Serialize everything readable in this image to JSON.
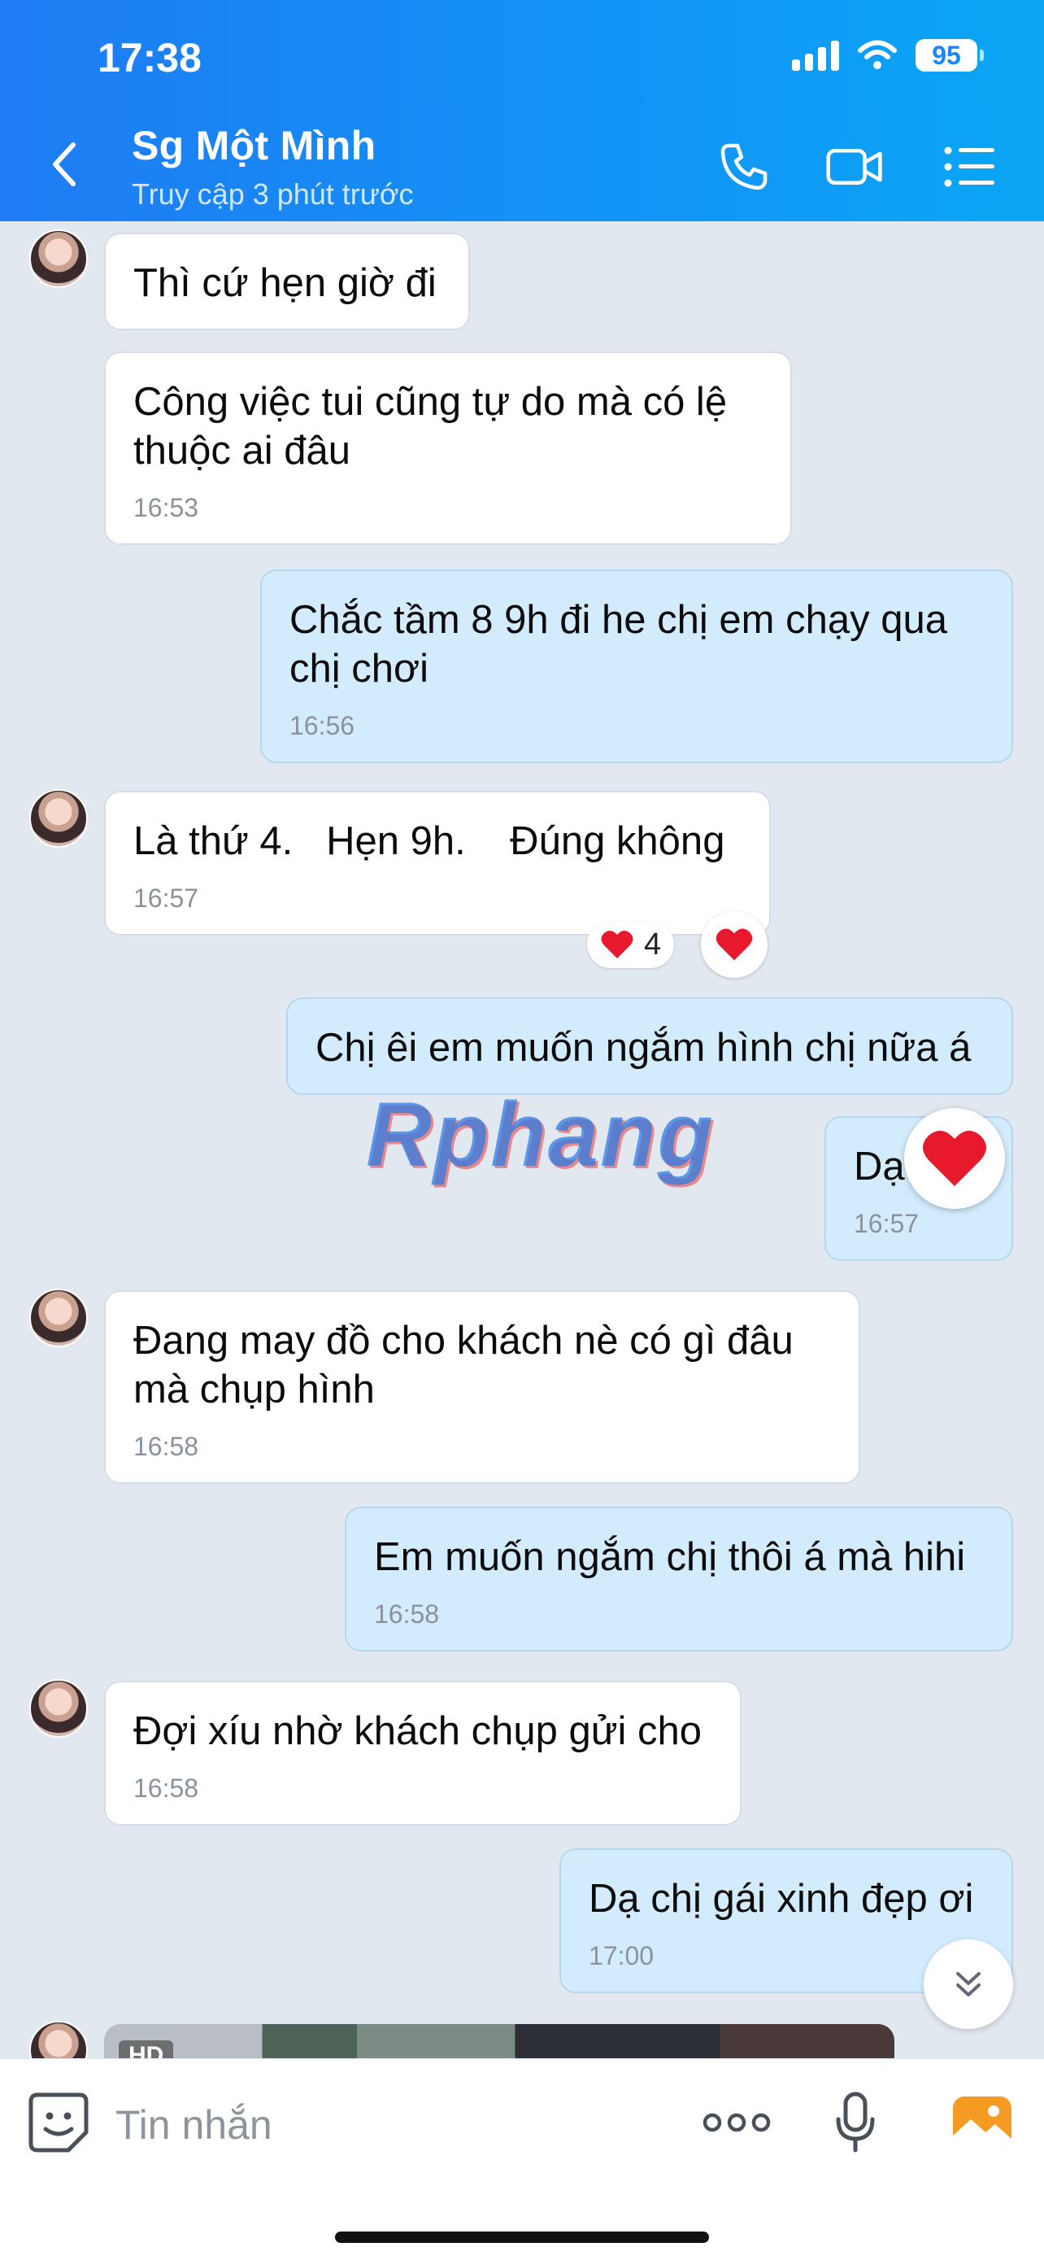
{
  "status_bar": {
    "time": "17:38",
    "battery": "95"
  },
  "header": {
    "title": "Sg Một Mình",
    "subtitle": "Truy cập 3 phút trước",
    "icons": [
      "back-icon",
      "phone-icon",
      "video-call-icon",
      "menu-list-icon"
    ]
  },
  "messages": [
    {
      "side": "in",
      "text": "Thì cứ hẹn giờ đi",
      "time": ""
    },
    {
      "side": "in",
      "text": "Công việc tui cũng tự do mà có lệ\nthuộc ai đâu",
      "time": "16:53"
    },
    {
      "side": "out",
      "text": "Chắc tầm 8 9h đi he chị em chạy qua\nchị chơi",
      "time": "16:56"
    },
    {
      "side": "in",
      "text": "Là thứ 4.   Hẹn 9h.    Đúng không",
      "time": "16:57",
      "reaction_count": "4"
    },
    {
      "side": "out",
      "text": "Chị êi em muốn ngắm hình chị nữa á",
      "time": ""
    },
    {
      "side": "out",
      "text": "Dạ",
      "time": "16:57"
    },
    {
      "side": "in",
      "text": "Đang may đồ cho khách nè có gì đâu\nmà chụp hình",
      "time": "16:58"
    },
    {
      "side": "out",
      "text": "Em muốn ngắm chị thôi á mà hihi",
      "time": "16:58"
    },
    {
      "side": "in",
      "text": "Đợi xíu nhờ khách chụp gửi cho",
      "time": "16:58"
    },
    {
      "side": "out",
      "text": "Dạ chị gái xinh đẹp ơi",
      "time": "17:00"
    }
  ],
  "media": {
    "badge": "HD"
  },
  "watermark": "Rphang",
  "composer": {
    "placeholder": "Tin nhắn"
  },
  "colors": {
    "header": "#1b86f5",
    "outgoing_bubble": "#d3ecfd",
    "incoming_bubble": "#ffffff",
    "background": "#e2e8f0",
    "heart": "#e8192c"
  }
}
